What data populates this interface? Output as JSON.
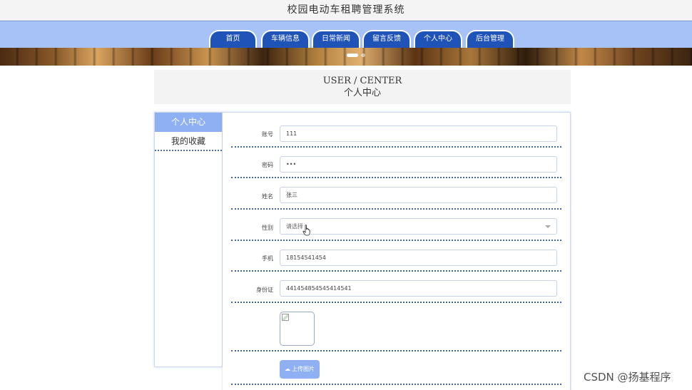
{
  "site": {
    "title": "校园电动车租聘管理系统"
  },
  "nav": {
    "tabs": [
      {
        "label": "首页"
      },
      {
        "label": "车辆信息"
      },
      {
        "label": "日常新闻"
      },
      {
        "label": "留言反馈"
      },
      {
        "label": "个人中心"
      },
      {
        "label": "后台管理"
      }
    ]
  },
  "section": {
    "title_en": "USER / CENTER",
    "title_cn": "个人中心"
  },
  "side_menu": {
    "items": [
      {
        "label": "个人中心",
        "active": true
      },
      {
        "label": "我的收藏",
        "active": false
      }
    ]
  },
  "form": {
    "account": {
      "label": "账号",
      "value": "111"
    },
    "password": {
      "label": "密码",
      "value": "•••"
    },
    "name": {
      "label": "姓名",
      "value": "张三"
    },
    "gender": {
      "label": "性别",
      "placeholder": "请选择"
    },
    "phone": {
      "label": "手机",
      "value": "18154541454"
    },
    "id_card": {
      "label": "身份证",
      "value": "441454854545414541"
    },
    "upload": {
      "label": "上传图片",
      "icon": "upload-cloud-icon"
    }
  },
  "watermark": {
    "text": "CSDN @扬基程序"
  },
  "colors": {
    "nav_bg": "#a7c2f6",
    "tab_bg": "#1f53b8",
    "accent": "#8fb0f2",
    "divider": "#3f64b8"
  }
}
